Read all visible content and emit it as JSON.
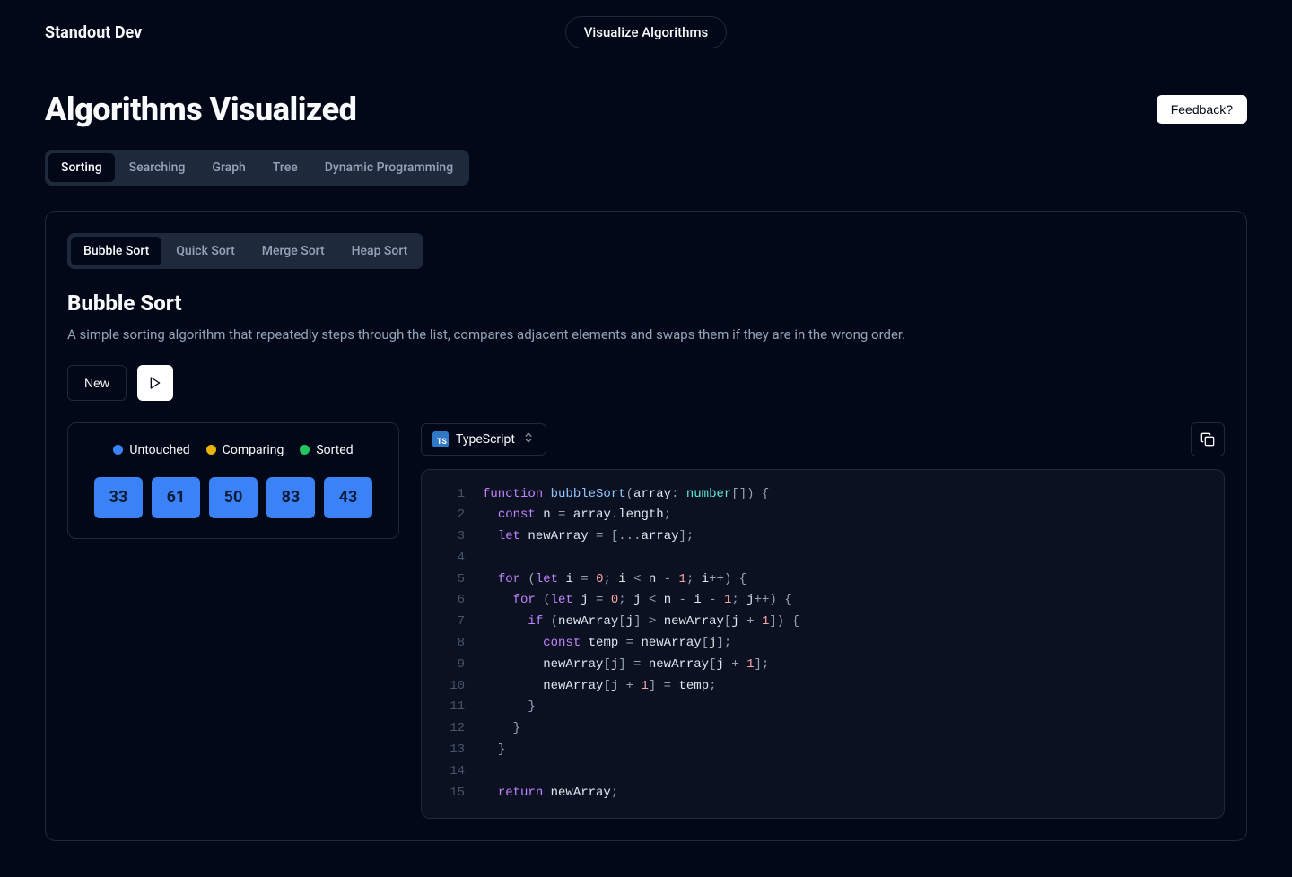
{
  "header": {
    "brand": "Standout Dev",
    "nav_link": "Visualize Algorithms"
  },
  "page": {
    "title": "Algorithms Visualized",
    "feedback_label": "Feedback?"
  },
  "categories": [
    "Sorting",
    "Searching",
    "Graph",
    "Tree",
    "Dynamic Programming"
  ],
  "active_category": "Sorting",
  "algorithms": [
    "Bubble Sort",
    "Quick Sort",
    "Merge Sort",
    "Heap Sort"
  ],
  "active_algorithm": "Bubble Sort",
  "algorithm": {
    "title": "Bubble Sort",
    "description": "A simple sorting algorithm that repeatedly steps through the list, compares adjacent elements and swaps them if they are in the wrong order."
  },
  "controls": {
    "new_label": "New"
  },
  "legend": {
    "untouched": "Untouched",
    "comparing": "Comparing",
    "sorted": "Sorted"
  },
  "array": [
    33,
    61,
    50,
    83,
    43
  ],
  "code": {
    "language": "TypeScript",
    "lines": [
      [
        {
          "c": "tk-kw",
          "t": "function "
        },
        {
          "c": "tk-fn",
          "t": "bubbleSort"
        },
        {
          "c": "tk-pn",
          "t": "("
        },
        {
          "c": "tk-id",
          "t": "array"
        },
        {
          "c": "tk-pn",
          "t": ": "
        },
        {
          "c": "tk-ty",
          "t": "number"
        },
        {
          "c": "tk-pn",
          "t": "[]) {"
        }
      ],
      [
        {
          "c": "tk-id",
          "t": "  "
        },
        {
          "c": "tk-kw",
          "t": "const "
        },
        {
          "c": "tk-id",
          "t": "n "
        },
        {
          "c": "tk-op",
          "t": "= "
        },
        {
          "c": "tk-id",
          "t": "array"
        },
        {
          "c": "tk-pn",
          "t": "."
        },
        {
          "c": "tk-id",
          "t": "length"
        },
        {
          "c": "tk-pn",
          "t": ";"
        }
      ],
      [
        {
          "c": "tk-id",
          "t": "  "
        },
        {
          "c": "tk-kw",
          "t": "let "
        },
        {
          "c": "tk-id",
          "t": "newArray "
        },
        {
          "c": "tk-op",
          "t": "= "
        },
        {
          "c": "tk-pn",
          "t": "["
        },
        {
          "c": "tk-op",
          "t": "..."
        },
        {
          "c": "tk-id",
          "t": "array"
        },
        {
          "c": "tk-pn",
          "t": "];"
        }
      ],
      [
        {
          "c": "tk-id",
          "t": ""
        }
      ],
      [
        {
          "c": "tk-id",
          "t": "  "
        },
        {
          "c": "tk-kw",
          "t": "for "
        },
        {
          "c": "tk-pn",
          "t": "("
        },
        {
          "c": "tk-kw",
          "t": "let "
        },
        {
          "c": "tk-id",
          "t": "i "
        },
        {
          "c": "tk-op",
          "t": "= "
        },
        {
          "c": "tk-nm",
          "t": "0"
        },
        {
          "c": "tk-pn",
          "t": "; "
        },
        {
          "c": "tk-id",
          "t": "i "
        },
        {
          "c": "tk-op",
          "t": "< "
        },
        {
          "c": "tk-id",
          "t": "n "
        },
        {
          "c": "tk-op",
          "t": "- "
        },
        {
          "c": "tk-nm",
          "t": "1"
        },
        {
          "c": "tk-pn",
          "t": "; "
        },
        {
          "c": "tk-id",
          "t": "i"
        },
        {
          "c": "tk-op",
          "t": "++"
        },
        {
          "c": "tk-pn",
          "t": ") {"
        }
      ],
      [
        {
          "c": "tk-id",
          "t": "    "
        },
        {
          "c": "tk-kw",
          "t": "for "
        },
        {
          "c": "tk-pn",
          "t": "("
        },
        {
          "c": "tk-kw",
          "t": "let "
        },
        {
          "c": "tk-id",
          "t": "j "
        },
        {
          "c": "tk-op",
          "t": "= "
        },
        {
          "c": "tk-nm",
          "t": "0"
        },
        {
          "c": "tk-pn",
          "t": "; "
        },
        {
          "c": "tk-id",
          "t": "j "
        },
        {
          "c": "tk-op",
          "t": "< "
        },
        {
          "c": "tk-id",
          "t": "n "
        },
        {
          "c": "tk-op",
          "t": "- "
        },
        {
          "c": "tk-id",
          "t": "i "
        },
        {
          "c": "tk-op",
          "t": "- "
        },
        {
          "c": "tk-nm",
          "t": "1"
        },
        {
          "c": "tk-pn",
          "t": "; "
        },
        {
          "c": "tk-id",
          "t": "j"
        },
        {
          "c": "tk-op",
          "t": "++"
        },
        {
          "c": "tk-pn",
          "t": ") {"
        }
      ],
      [
        {
          "c": "tk-id",
          "t": "      "
        },
        {
          "c": "tk-kw",
          "t": "if "
        },
        {
          "c": "tk-pn",
          "t": "("
        },
        {
          "c": "tk-id",
          "t": "newArray"
        },
        {
          "c": "tk-pn",
          "t": "["
        },
        {
          "c": "tk-id",
          "t": "j"
        },
        {
          "c": "tk-pn",
          "t": "] "
        },
        {
          "c": "tk-op",
          "t": "> "
        },
        {
          "c": "tk-id",
          "t": "newArray"
        },
        {
          "c": "tk-pn",
          "t": "["
        },
        {
          "c": "tk-id",
          "t": "j "
        },
        {
          "c": "tk-op",
          "t": "+ "
        },
        {
          "c": "tk-nm",
          "t": "1"
        },
        {
          "c": "tk-pn",
          "t": "]) {"
        }
      ],
      [
        {
          "c": "tk-id",
          "t": "        "
        },
        {
          "c": "tk-kw",
          "t": "const "
        },
        {
          "c": "tk-id",
          "t": "temp "
        },
        {
          "c": "tk-op",
          "t": "= "
        },
        {
          "c": "tk-id",
          "t": "newArray"
        },
        {
          "c": "tk-pn",
          "t": "["
        },
        {
          "c": "tk-id",
          "t": "j"
        },
        {
          "c": "tk-pn",
          "t": "];"
        }
      ],
      [
        {
          "c": "tk-id",
          "t": "        newArray"
        },
        {
          "c": "tk-pn",
          "t": "["
        },
        {
          "c": "tk-id",
          "t": "j"
        },
        {
          "c": "tk-pn",
          "t": "] "
        },
        {
          "c": "tk-op",
          "t": "= "
        },
        {
          "c": "tk-id",
          "t": "newArray"
        },
        {
          "c": "tk-pn",
          "t": "["
        },
        {
          "c": "tk-id",
          "t": "j "
        },
        {
          "c": "tk-op",
          "t": "+ "
        },
        {
          "c": "tk-nm",
          "t": "1"
        },
        {
          "c": "tk-pn",
          "t": "];"
        }
      ],
      [
        {
          "c": "tk-id",
          "t": "        newArray"
        },
        {
          "c": "tk-pn",
          "t": "["
        },
        {
          "c": "tk-id",
          "t": "j "
        },
        {
          "c": "tk-op",
          "t": "+ "
        },
        {
          "c": "tk-nm",
          "t": "1"
        },
        {
          "c": "tk-pn",
          "t": "] "
        },
        {
          "c": "tk-op",
          "t": "= "
        },
        {
          "c": "tk-id",
          "t": "temp"
        },
        {
          "c": "tk-pn",
          "t": ";"
        }
      ],
      [
        {
          "c": "tk-id",
          "t": "      "
        },
        {
          "c": "tk-pn",
          "t": "}"
        }
      ],
      [
        {
          "c": "tk-id",
          "t": "    "
        },
        {
          "c": "tk-pn",
          "t": "}"
        }
      ],
      [
        {
          "c": "tk-id",
          "t": "  "
        },
        {
          "c": "tk-pn",
          "t": "}"
        }
      ],
      [
        {
          "c": "tk-id",
          "t": ""
        }
      ],
      [
        {
          "c": "tk-id",
          "t": "  "
        },
        {
          "c": "tk-kw",
          "t": "return "
        },
        {
          "c": "tk-id",
          "t": "newArray"
        },
        {
          "c": "tk-pn",
          "t": ";"
        }
      ]
    ]
  }
}
